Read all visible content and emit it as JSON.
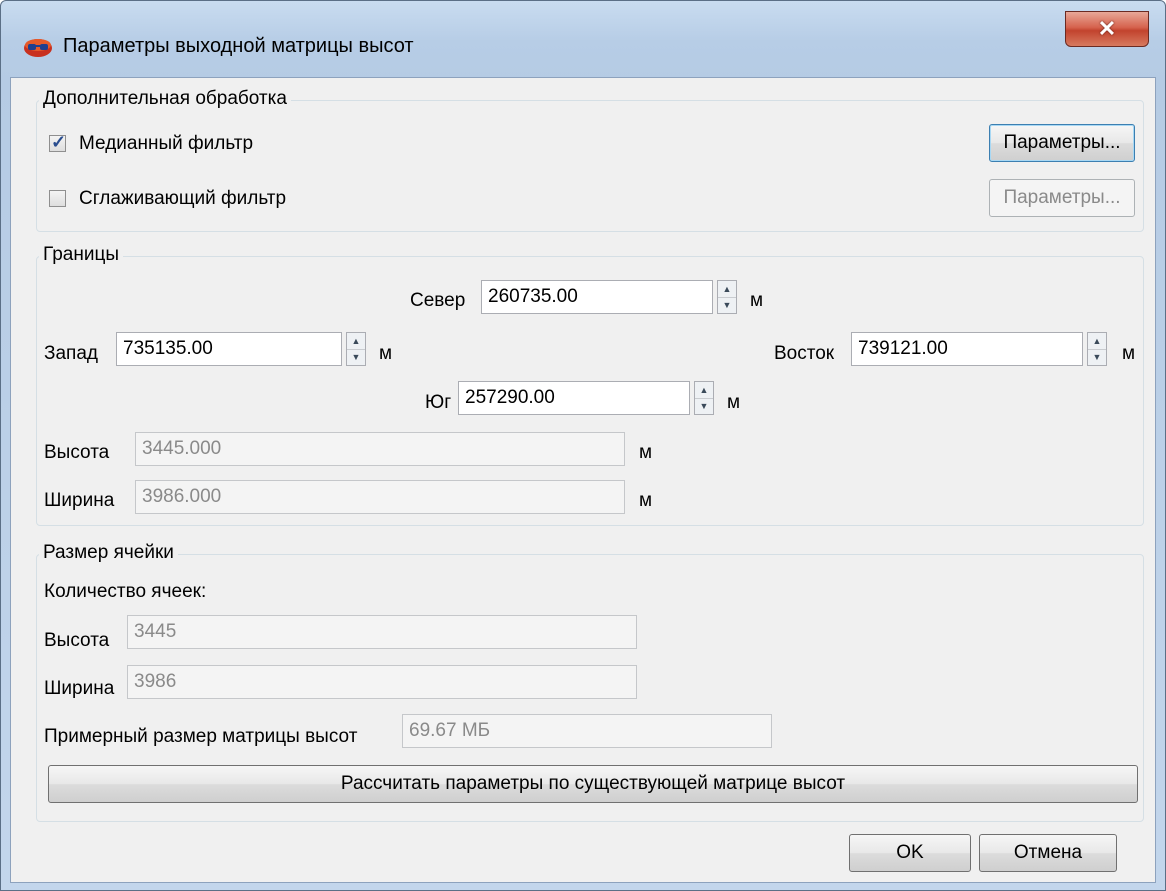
{
  "window": {
    "title": "Параметры выходной матрицы высот",
    "close_glyph": "✕"
  },
  "processing": {
    "group_title": "Дополнительная обработка",
    "median": {
      "label": "Медианный фильтр",
      "checked": true,
      "params_label": "Параметры..."
    },
    "smoothing": {
      "label": "Сглаживающий фильтр",
      "checked": false,
      "params_label": "Параметры..."
    }
  },
  "bounds": {
    "group_title": "Границы",
    "north": {
      "label": "Север",
      "value": "260735.00",
      "unit": "м"
    },
    "west": {
      "label": "Запад",
      "value": "735135.00",
      "unit": "м"
    },
    "east": {
      "label": "Восток",
      "value": "739121.00",
      "unit": "м"
    },
    "south": {
      "label": "Юг",
      "value": "257290.00",
      "unit": "м"
    },
    "height": {
      "label": "Высота",
      "value": "3445.000",
      "unit": "м"
    },
    "width": {
      "label": "Ширина",
      "value": "3986.000",
      "unit": "м"
    }
  },
  "cell": {
    "group_title": "Размер ячейки",
    "count_label": "Количество ячеек:",
    "height": {
      "label": "Высота",
      "value": "3445"
    },
    "width": {
      "label": "Ширина",
      "value": "3986"
    },
    "approx_size": {
      "label": "Примерный размер матрицы высот",
      "value": "69.67 МБ"
    },
    "calc_button": "Рассчитать параметры по существующей матрице высот"
  },
  "footer": {
    "ok_label": "OK",
    "cancel_label": "Отмена"
  }
}
